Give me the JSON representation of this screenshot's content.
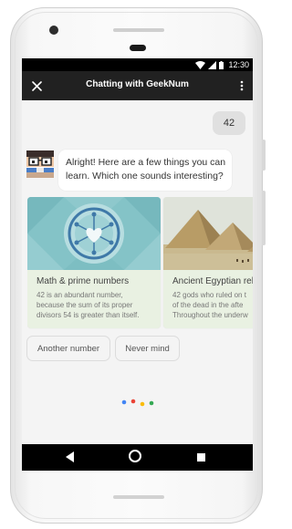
{
  "status_bar": {
    "time": "12:30"
  },
  "app_bar": {
    "title": "Chatting with GeekNum"
  },
  "chat": {
    "user_message": "42",
    "bot_message": "Alright! Here are a few things you can learn. Which one sounds interesting?"
  },
  "cards": [
    {
      "title": "Math & prime numbers",
      "description": "42 is an abundant number,\nbecause the sum of its proper\ndivisors 54 is greater than itself."
    },
    {
      "title": "Ancient Egyptian reli",
      "description": "42 gods who ruled on t\nof the dead in the afte\nThroughout the underw"
    }
  ],
  "suggestions": [
    "Another number",
    "Never mind"
  ],
  "colors": {
    "app_bar": "#212121",
    "screen_bg": "#f4f4f4",
    "card_bg": "#e9f1e2",
    "math_image_bg": "#84c3c7",
    "dot_blue": "#4285F4",
    "dot_red": "#EA4335",
    "dot_yellow": "#FBBC05",
    "dot_green": "#34A853"
  }
}
